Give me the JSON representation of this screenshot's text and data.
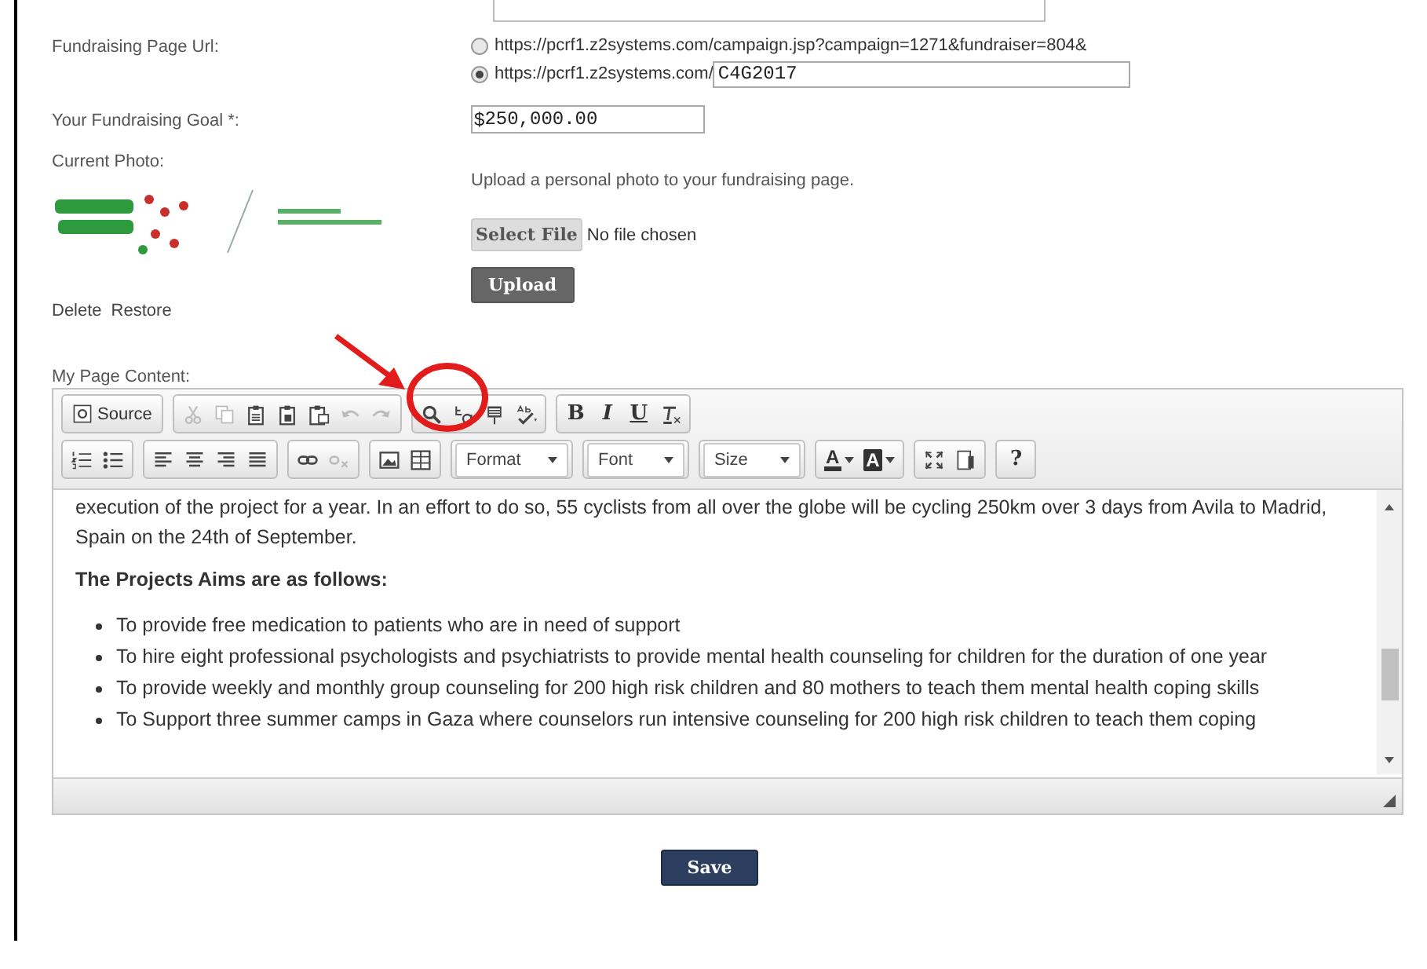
{
  "fundraising_url": {
    "label": "Fundraising Page Url:",
    "options": [
      {
        "text": "https://pcrf1.z2systems.com/campaign.jsp?campaign=1271&fundraiser=804&",
        "selected": false
      },
      {
        "text": "https://pcrf1.z2systems.com/",
        "value": "C4G2017",
        "selected": true
      }
    ]
  },
  "goal": {
    "label": "Your Fundraising Goal *:",
    "prefix": "$",
    "value": "250,000.00"
  },
  "photo": {
    "label": "Current Photo:",
    "links": [
      "Delete",
      "Restore"
    ],
    "upload_hint": "Upload a personal photo to your fundraising page.",
    "select_button": "Select File",
    "file_status": "No file chosen",
    "upload_button": "Upload"
  },
  "content": {
    "label": "My Page Content:",
    "toolbar": [
      [
        [
          {
            "kind": "button",
            "label": "Source"
          }
        ],
        [
          {
            "kind": "icon",
            "disabled": true
          },
          {
            "kind": "icon",
            "disabled": true
          },
          {
            "kind": "icon",
            "disabled": false
          },
          {
            "kind": "icon",
            "disabled": false
          },
          {
            "kind": "icon",
            "disabled": false
          },
          {
            "kind": "icon",
            "disabled": true
          },
          {
            "kind": "icon",
            "disabled": true
          }
        ],
        [
          {
            "kind": "icon",
            "disabled": false
          },
          {
            "kind": "icon",
            "disabled": false
          },
          {
            "kind": "icon",
            "disabled": false
          },
          {
            "kind": "icon",
            "disabled": false
          }
        ],
        [
          {
            "kind": "text",
            "label": "B"
          },
          {
            "kind": "text",
            "label": "I"
          },
          {
            "kind": "text",
            "label": "U"
          },
          {
            "kind": "icon",
            "disabled": false
          }
        ]
      ],
      [
        [
          {
            "kind": "icon",
            "disabled": false
          },
          {
            "kind": "icon",
            "disabled": false
          }
        ],
        [
          {
            "kind": "icon",
            "disabled": false
          },
          {
            "kind": "icon",
            "disabled": false
          },
          {
            "kind": "icon",
            "disabled": false
          },
          {
            "kind": "icon",
            "disabled": false
          }
        ],
        [
          {
            "kind": "icon",
            "disabled": false
          },
          {
            "kind": "icon",
            "disabled": true
          }
        ],
        [
          {
            "kind": "icon",
            "disabled": false
          },
          {
            "kind": "icon",
            "disabled": false
          }
        ],
        [
          {
            "kind": "combo",
            "label": "Format"
          }
        ],
        [
          {
            "kind": "combo",
            "label": "Font"
          }
        ],
        [
          {
            "kind": "combo",
            "label": "Size"
          }
        ],
        [
          {
            "kind": "color",
            "label": "A",
            "filled": false
          },
          {
            "kind": "color",
            "label": "A",
            "filled": true
          }
        ],
        [
          {
            "kind": "icon",
            "disabled": false
          },
          {
            "kind": "icon",
            "disabled": false
          }
        ],
        [
          {
            "kind": "text",
            "label": "?"
          }
        ]
      ]
    ],
    "paragraph": "execution of the project for a year. In an effort to do so, 55 cyclists from all over the globe will be cycling 250km over 3 days from Avila to Madrid, Spain on the 24th of September.",
    "heading": "The Projects Aims are as follows:",
    "bullets": [
      "To provide free medication to patients who are in need of support",
      "To hire eight professional psychologists and psychiatrists to provide mental health counseling for children for the duration of one year",
      "To provide weekly and monthly group counseling for 200 high risk children and 80 mothers to teach them mental health coping skills",
      "To Support three summer camps in Gaza where counselors run intensive counseling for 200 high risk children to teach them coping"
    ]
  },
  "save_button": "Save"
}
